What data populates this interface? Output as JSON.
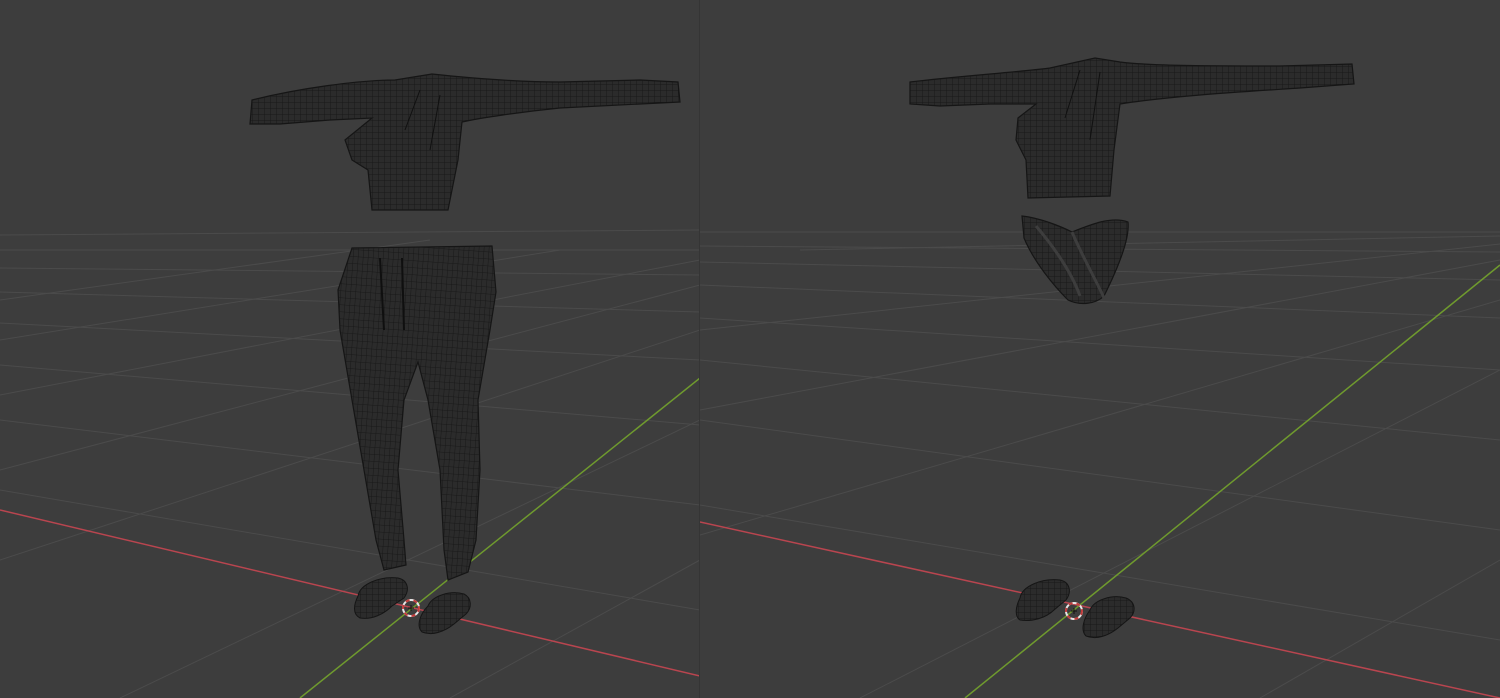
{
  "app": {
    "name": "3D viewport",
    "background": "#3d3d3d"
  },
  "colors": {
    "grid": "#4a4a4a",
    "x_axis": "#b9454f",
    "y_axis": "#6f9a2e",
    "mesh_fill": "#2a2a2a",
    "mesh_wire": "#111111",
    "cursor_ring": "#e6e6e6",
    "cursor_dash": "#c23b3b"
  },
  "viewports": [
    {
      "name": "viewport-left",
      "objects": [
        "sweater",
        "joggers",
        "left-slipper",
        "right-slipper"
      ],
      "icon": "3d-cursor-icon"
    },
    {
      "name": "viewport-right",
      "objects": [
        "sweater",
        "thong",
        "left-slipper",
        "right-slipper"
      ],
      "icon": "3d-cursor-icon"
    }
  ]
}
